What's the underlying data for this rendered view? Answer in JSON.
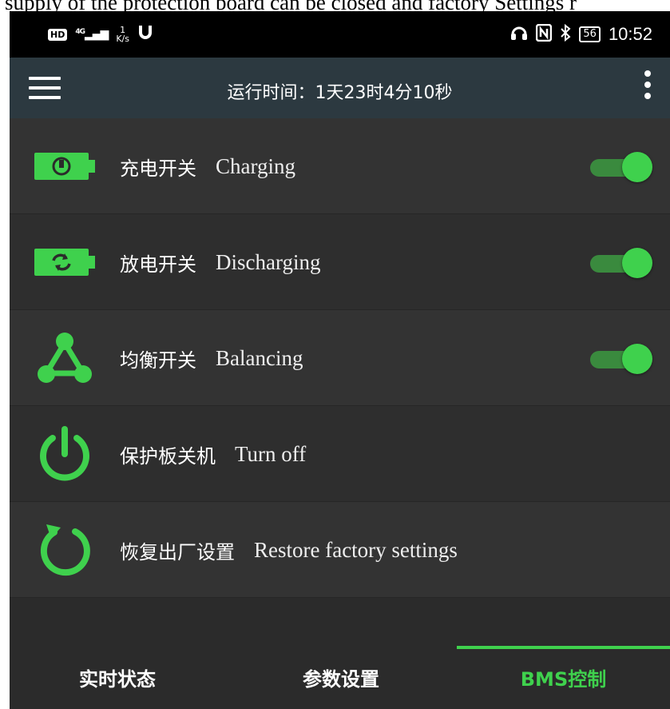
{
  "caption": "supply of the protection board can be closed and factory Settings r",
  "status_bar": {
    "hd": "HD",
    "signal": "4G",
    "net_speed_value": "1",
    "net_speed_unit": "K/s",
    "battery": "56",
    "time": "10:52"
  },
  "app_bar": {
    "runtime_text": "运行时间：1天23时4分10秒"
  },
  "controls": [
    {
      "label_zh": "充电开关",
      "label_en": "Charging",
      "icon": "battery-charging-icon",
      "toggle_on": true
    },
    {
      "label_zh": "放电开关",
      "label_en": "Discharging",
      "icon": "battery-refresh-icon",
      "toggle_on": true
    },
    {
      "label_zh": "均衡开关",
      "label_en": "Balancing",
      "icon": "balance-network-icon",
      "toggle_on": true
    },
    {
      "label_zh": "保护板关机",
      "label_en": "Turn off",
      "icon": "power-icon"
    },
    {
      "label_zh": "恢复出厂设置",
      "label_en": "Restore factory settings",
      "icon": "restore-icon"
    }
  ],
  "bottom_nav": {
    "tabs": [
      "实时状态",
      "参数设置",
      "BMS控制"
    ],
    "active_index": 2
  },
  "colors": {
    "accent": "#3fd14d",
    "appbar": "#2c3940",
    "background": "#2b2b2b",
    "row_alt": "#333333"
  }
}
